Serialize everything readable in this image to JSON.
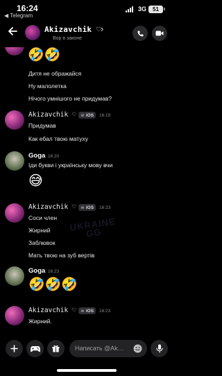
{
  "status": {
    "time": "16:24",
    "back_app": "◀ Telegram",
    "network": "3G",
    "battery": "51"
  },
  "header": {
    "name": "Akizavchik ♡",
    "chevron": "›",
    "subtitle": "Вор в законе"
  },
  "messages": {
    "first": {
      "emoji": "🤣🤣",
      "lines": [
        "Дитя не ображайся",
        "Ну малолетка",
        "Нічого умнішого не придумав?"
      ]
    },
    "akiz1": {
      "author": "Akizavchik ♡",
      "badge": "iOS",
      "time": "16:19",
      "lines": [
        "Придумав",
        "Как ебал твою матуху"
      ]
    },
    "goga1": {
      "author": "Goga",
      "time": "16:20",
      "lines": [
        "Іди букви і українську мову вчи"
      ],
      "emoji": "😅"
    },
    "akiz2": {
      "author": "Akizavchik ♡",
      "badge": "iOS",
      "time": "16:23",
      "lines": [
        "Соси член",
        "Жирний",
        "Заблювок",
        "Мать твою на зуб вертів"
      ]
    },
    "goga2": {
      "author": "Goga",
      "time": "16:23",
      "emoji": "🤣🤣🤣"
    },
    "akiz3": {
      "author": "Akizavchik ♡",
      "badge": "iOS",
      "time": "16:23",
      "lines": [
        "Жирний."
      ]
    }
  },
  "watermark": {
    "line1": "UKRAINE",
    "line2": "GG"
  },
  "composer": {
    "placeholder": "Написать @Ak…"
  },
  "icons": [
    "back-arrow-icon",
    "phone-icon",
    "video-icon",
    "plus-icon",
    "gamepad-icon",
    "gift-icon",
    "smile-icon",
    "microphone-icon",
    "skull-icon"
  ],
  "colors": {
    "background": "#000000",
    "surface": "#232326",
    "muted": "#8a8a8a"
  }
}
